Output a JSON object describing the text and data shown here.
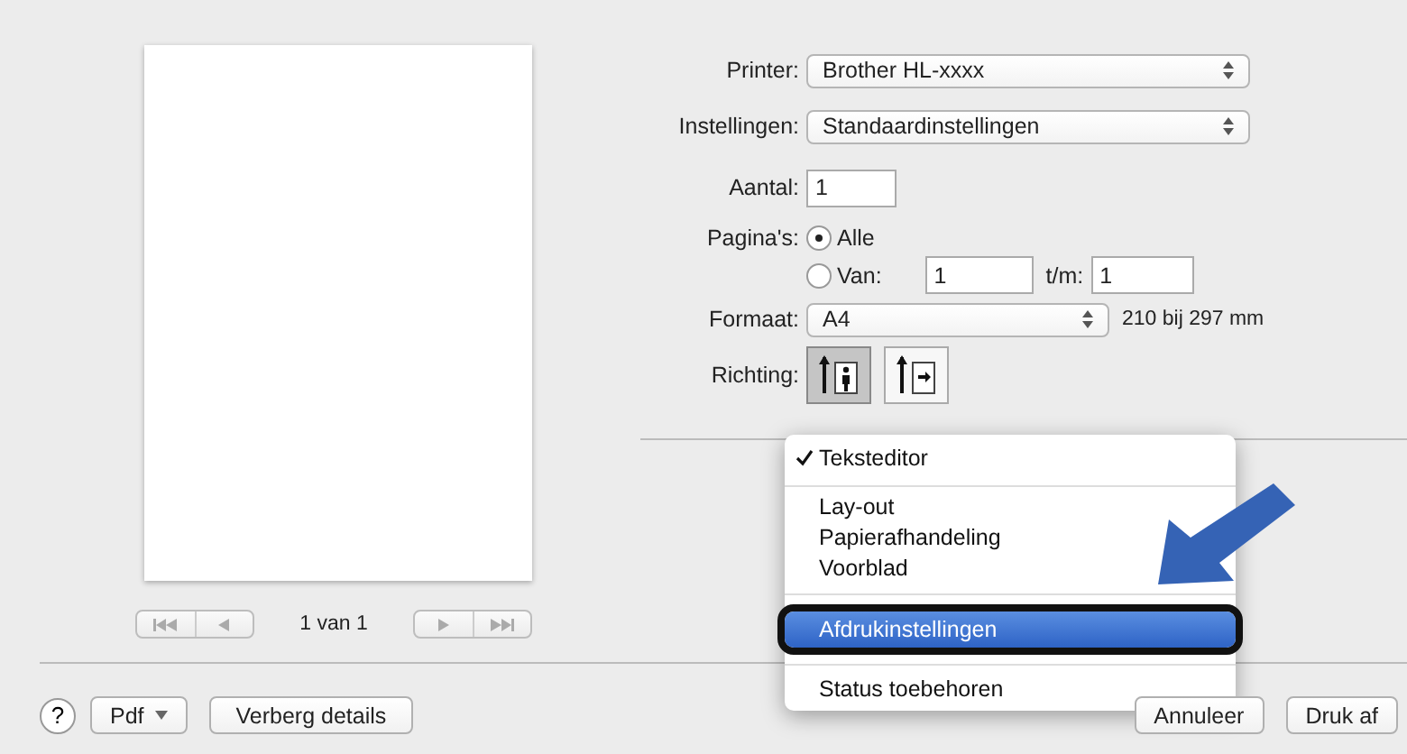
{
  "preview": {
    "page_label": "1 van 1"
  },
  "settings": {
    "printer": {
      "label": "Printer:",
      "value": "Brother HL-xxxx"
    },
    "preset": {
      "label": "Instellingen:",
      "value": "Standaardinstellingen"
    },
    "copies": {
      "label": "Aantal:",
      "value": "1"
    },
    "pages": {
      "label": "Pagina's:",
      "options": [
        {
          "label": "Alle",
          "selected": true
        },
        {
          "label": "Van:",
          "selected": false
        }
      ],
      "from": "1",
      "to_label": "t/m:",
      "to": "1"
    },
    "paper_size": {
      "label": "Formaat:",
      "value": "A4",
      "dimensions": "210 bij 297 mm"
    },
    "orientation": {
      "label": "Richting:",
      "options": [
        {
          "kind": "portrait",
          "selected": true
        },
        {
          "kind": "landscape",
          "selected": false
        }
      ]
    }
  },
  "menu": {
    "sections": [
      [
        {
          "label": "Teksteditor",
          "checked": true,
          "selected": false
        }
      ],
      [
        {
          "label": "Lay-out",
          "checked": false,
          "selected": false
        },
        {
          "label": "Papierafhandeling",
          "checked": false,
          "selected": false
        },
        {
          "label": "Voorblad",
          "checked": false,
          "selected": false
        }
      ],
      [
        {
          "label": "Afdrukinstellingen",
          "checked": false,
          "selected": true
        }
      ],
      [
        {
          "label": "Status toebehoren",
          "checked": false,
          "selected": false
        }
      ]
    ]
  },
  "buttons": {
    "help": "?",
    "pdf": "Pdf",
    "details": "Verberg details",
    "cancel": "Annuleer",
    "print": "Druk af"
  }
}
